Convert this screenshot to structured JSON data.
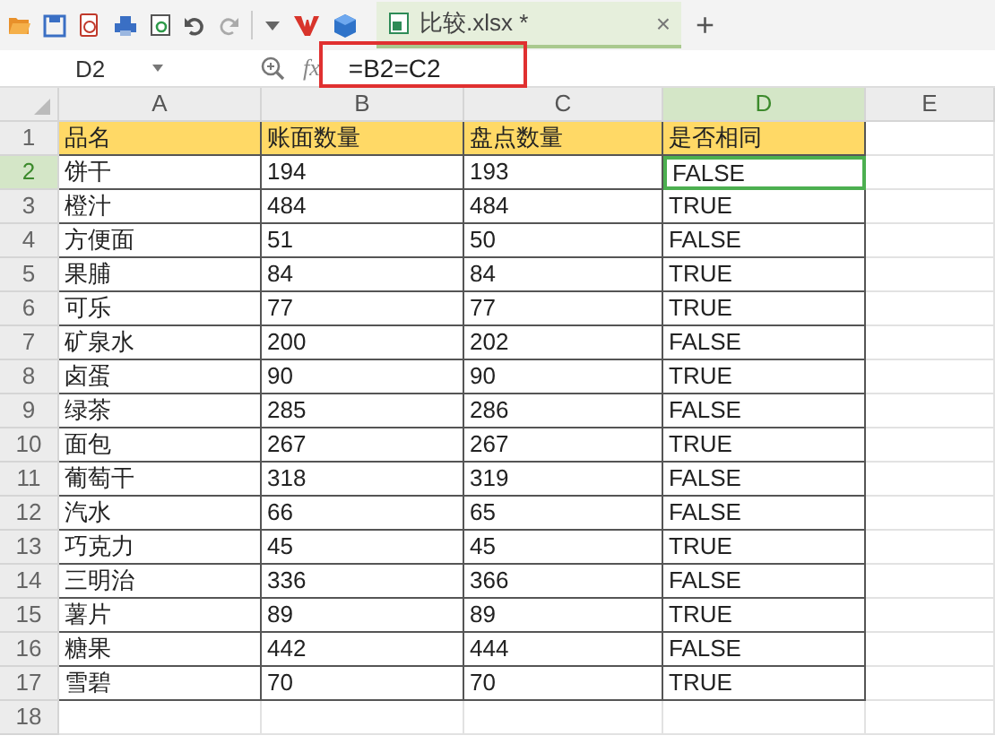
{
  "document_tab": {
    "title": "比较.xlsx *",
    "selected": true,
    "close": "×",
    "new_tab": "+"
  },
  "formula_bar": {
    "name_box": "D2",
    "fx": "fx",
    "formula": "=B2=C2"
  },
  "columns": [
    {
      "label": "A",
      "selected": false
    },
    {
      "label": "B",
      "selected": false
    },
    {
      "label": "C",
      "selected": false
    },
    {
      "label": "D",
      "selected": true
    },
    {
      "label": "E",
      "selected": false
    }
  ],
  "rows": [
    {
      "number": "1",
      "selected": false,
      "kind": "header",
      "cells": [
        {
          "text": "品名",
          "selected": false
        },
        {
          "text": "账面数量",
          "selected": false
        },
        {
          "text": "盘点数量",
          "selected": false
        },
        {
          "text": "是否相同",
          "selected": false
        }
      ]
    },
    {
      "number": "2",
      "selected": true,
      "kind": "data",
      "cells": [
        {
          "text": "饼干",
          "selected": false
        },
        {
          "text": "194",
          "selected": false
        },
        {
          "text": "193",
          "selected": false
        },
        {
          "text": "FALSE",
          "selected": true
        }
      ]
    },
    {
      "number": "3",
      "selected": false,
      "kind": "data",
      "cells": [
        {
          "text": "橙汁",
          "selected": false
        },
        {
          "text": "484",
          "selected": false
        },
        {
          "text": "484",
          "selected": false
        },
        {
          "text": "TRUE",
          "selected": false
        }
      ]
    },
    {
      "number": "4",
      "selected": false,
      "kind": "data",
      "cells": [
        {
          "text": "方便面",
          "selected": false
        },
        {
          "text": "51",
          "selected": false
        },
        {
          "text": "50",
          "selected": false
        },
        {
          "text": "FALSE",
          "selected": false
        }
      ]
    },
    {
      "number": "5",
      "selected": false,
      "kind": "data",
      "cells": [
        {
          "text": "果脯",
          "selected": false
        },
        {
          "text": "84",
          "selected": false
        },
        {
          "text": "84",
          "selected": false
        },
        {
          "text": "TRUE",
          "selected": false
        }
      ]
    },
    {
      "number": "6",
      "selected": false,
      "kind": "data",
      "cells": [
        {
          "text": "可乐",
          "selected": false
        },
        {
          "text": "77",
          "selected": false
        },
        {
          "text": "77",
          "selected": false
        },
        {
          "text": "TRUE",
          "selected": false
        }
      ]
    },
    {
      "number": "7",
      "selected": false,
      "kind": "data",
      "cells": [
        {
          "text": "矿泉水",
          "selected": false
        },
        {
          "text": "200",
          "selected": false
        },
        {
          "text": "202",
          "selected": false
        },
        {
          "text": "FALSE",
          "selected": false
        }
      ]
    },
    {
      "number": "8",
      "selected": false,
      "kind": "data",
      "cells": [
        {
          "text": "卤蛋",
          "selected": false
        },
        {
          "text": "90",
          "selected": false
        },
        {
          "text": "90",
          "selected": false
        },
        {
          "text": "TRUE",
          "selected": false
        }
      ]
    },
    {
      "number": "9",
      "selected": false,
      "kind": "data",
      "cells": [
        {
          "text": "绿茶",
          "selected": false
        },
        {
          "text": "285",
          "selected": false
        },
        {
          "text": "286",
          "selected": false
        },
        {
          "text": "FALSE",
          "selected": false
        }
      ]
    },
    {
      "number": "10",
      "selected": false,
      "kind": "data",
      "cells": [
        {
          "text": "面包",
          "selected": false
        },
        {
          "text": "267",
          "selected": false
        },
        {
          "text": "267",
          "selected": false
        },
        {
          "text": "TRUE",
          "selected": false
        }
      ]
    },
    {
      "number": "11",
      "selected": false,
      "kind": "data",
      "cells": [
        {
          "text": "葡萄干",
          "selected": false
        },
        {
          "text": "318",
          "selected": false
        },
        {
          "text": "319",
          "selected": false
        },
        {
          "text": "FALSE",
          "selected": false
        }
      ]
    },
    {
      "number": "12",
      "selected": false,
      "kind": "data",
      "cells": [
        {
          "text": "汽水",
          "selected": false
        },
        {
          "text": "66",
          "selected": false
        },
        {
          "text": "65",
          "selected": false
        },
        {
          "text": "FALSE",
          "selected": false
        }
      ]
    },
    {
      "number": "13",
      "selected": false,
      "kind": "data",
      "cells": [
        {
          "text": "巧克力",
          "selected": false
        },
        {
          "text": "45",
          "selected": false
        },
        {
          "text": "45",
          "selected": false
        },
        {
          "text": "TRUE",
          "selected": false
        }
      ]
    },
    {
      "number": "14",
      "selected": false,
      "kind": "data",
      "cells": [
        {
          "text": "三明治",
          "selected": false
        },
        {
          "text": "336",
          "selected": false
        },
        {
          "text": "366",
          "selected": false
        },
        {
          "text": "FALSE",
          "selected": false
        }
      ]
    },
    {
      "number": "15",
      "selected": false,
      "kind": "data",
      "cells": [
        {
          "text": "薯片",
          "selected": false
        },
        {
          "text": "89",
          "selected": false
        },
        {
          "text": "89",
          "selected": false
        },
        {
          "text": "TRUE",
          "selected": false
        }
      ]
    },
    {
      "number": "16",
      "selected": false,
      "kind": "data",
      "cells": [
        {
          "text": "糖果",
          "selected": false
        },
        {
          "text": "442",
          "selected": false
        },
        {
          "text": "444",
          "selected": false
        },
        {
          "text": "FALSE",
          "selected": false
        }
      ]
    },
    {
      "number": "17",
      "selected": false,
      "kind": "data",
      "cells": [
        {
          "text": "雪碧",
          "selected": false
        },
        {
          "text": "70",
          "selected": false
        },
        {
          "text": "70",
          "selected": false
        },
        {
          "text": "TRUE",
          "selected": false
        }
      ]
    },
    {
      "number": "18",
      "selected": false,
      "kind": "empty",
      "cells": []
    }
  ]
}
